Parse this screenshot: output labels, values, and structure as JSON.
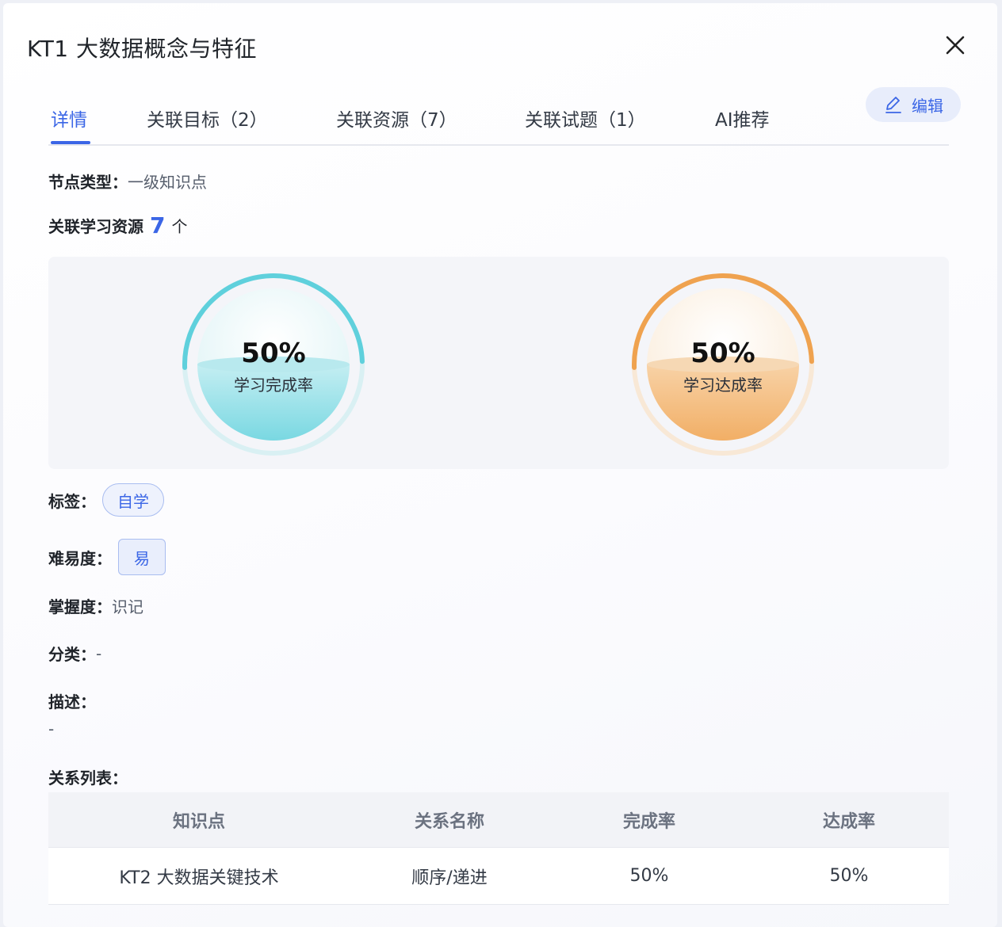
{
  "dialog": {
    "title": "KT1 大数据概念与特征",
    "edit_label": "编辑"
  },
  "tabs": [
    {
      "label": "详情",
      "active": true
    },
    {
      "label": "关联目标（2）",
      "active": false
    },
    {
      "label": "关联资源（7）",
      "active": false
    },
    {
      "label": "关联试题（1）",
      "active": false
    },
    {
      "label": "AI推荐",
      "active": false
    }
  ],
  "details": {
    "node_type_label": "节点类型：",
    "node_type_value": "一级知识点",
    "resources_prefix": "关联学习资源",
    "resources_count": "7",
    "resources_suffix": "个"
  },
  "stats": [
    {
      "value": "50%",
      "label": "学习完成率",
      "fraction": 0.5,
      "color": "#5fd0dc"
    },
    {
      "value": "50%",
      "label": "学习达成率",
      "fraction": 0.5,
      "color": "#efa24f"
    }
  ],
  "tags": {
    "label": "标签：",
    "items": [
      "自学"
    ]
  },
  "difficulty": {
    "label": "难易度：",
    "value": "易"
  },
  "mastery": {
    "label": "掌握度：",
    "value": "识记"
  },
  "category": {
    "label": "分类：",
    "value": "-"
  },
  "description": {
    "label": "描述：",
    "value": "-"
  },
  "relations": {
    "label": "关系列表：",
    "columns": [
      "知识点",
      "关系名称",
      "完成率",
      "达成率"
    ],
    "rows": [
      [
        "KT2 大数据关键技术",
        "顺序/递进",
        "50%",
        "50%"
      ]
    ]
  },
  "colors": {
    "accent": "#3b66e6",
    "cyan": "#5fd0dc",
    "orange": "#efa24f"
  }
}
